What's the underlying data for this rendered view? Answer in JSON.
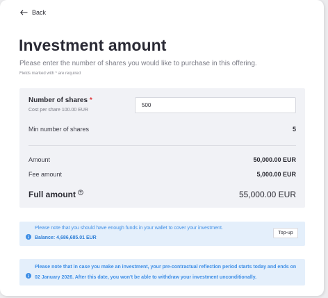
{
  "nav": {
    "back_label": "Back"
  },
  "header": {
    "title": "Investment amount",
    "subtitle": "Please enter the number of shares you would like to purchase in this offering.",
    "required_note": "Fields marked with * are required"
  },
  "form": {
    "shares_label": "Number of shares",
    "required_mark": "*",
    "cost_per_share": "Cost per share 100.00 EUR",
    "shares_value": "500"
  },
  "summary": {
    "min_shares_label": "Min number of shares",
    "min_shares_value": "5",
    "amount_label": "Amount",
    "amount_value": "50,000.00 EUR",
    "fee_label": "Fee amount",
    "fee_value": "5,000.00 EUR",
    "full_label": "Full amount",
    "full_value": "55,000.00 EUR"
  },
  "notices": {
    "wallet_text": "Please note that you should have enough funds in your wallet to cover your investment.",
    "balance": "Balance: 4,686,685.01 EUR",
    "topup_label": "Top-up",
    "reflection_text": "Please note that in case you make an investment, your pre-contractual reflection period starts today and ends on 02 January 2026. After this date, you won't be able to withdraw your investment unconditionally."
  },
  "colors": {
    "accent": "#3d8ee6",
    "required": "#e0363b",
    "panel_bg": "#f1f2f6",
    "notice_bg": "#e4effb"
  },
  "icons": {
    "back": "arrow-left-icon",
    "info": "info-circle-icon",
    "help": "help-circle-icon"
  }
}
